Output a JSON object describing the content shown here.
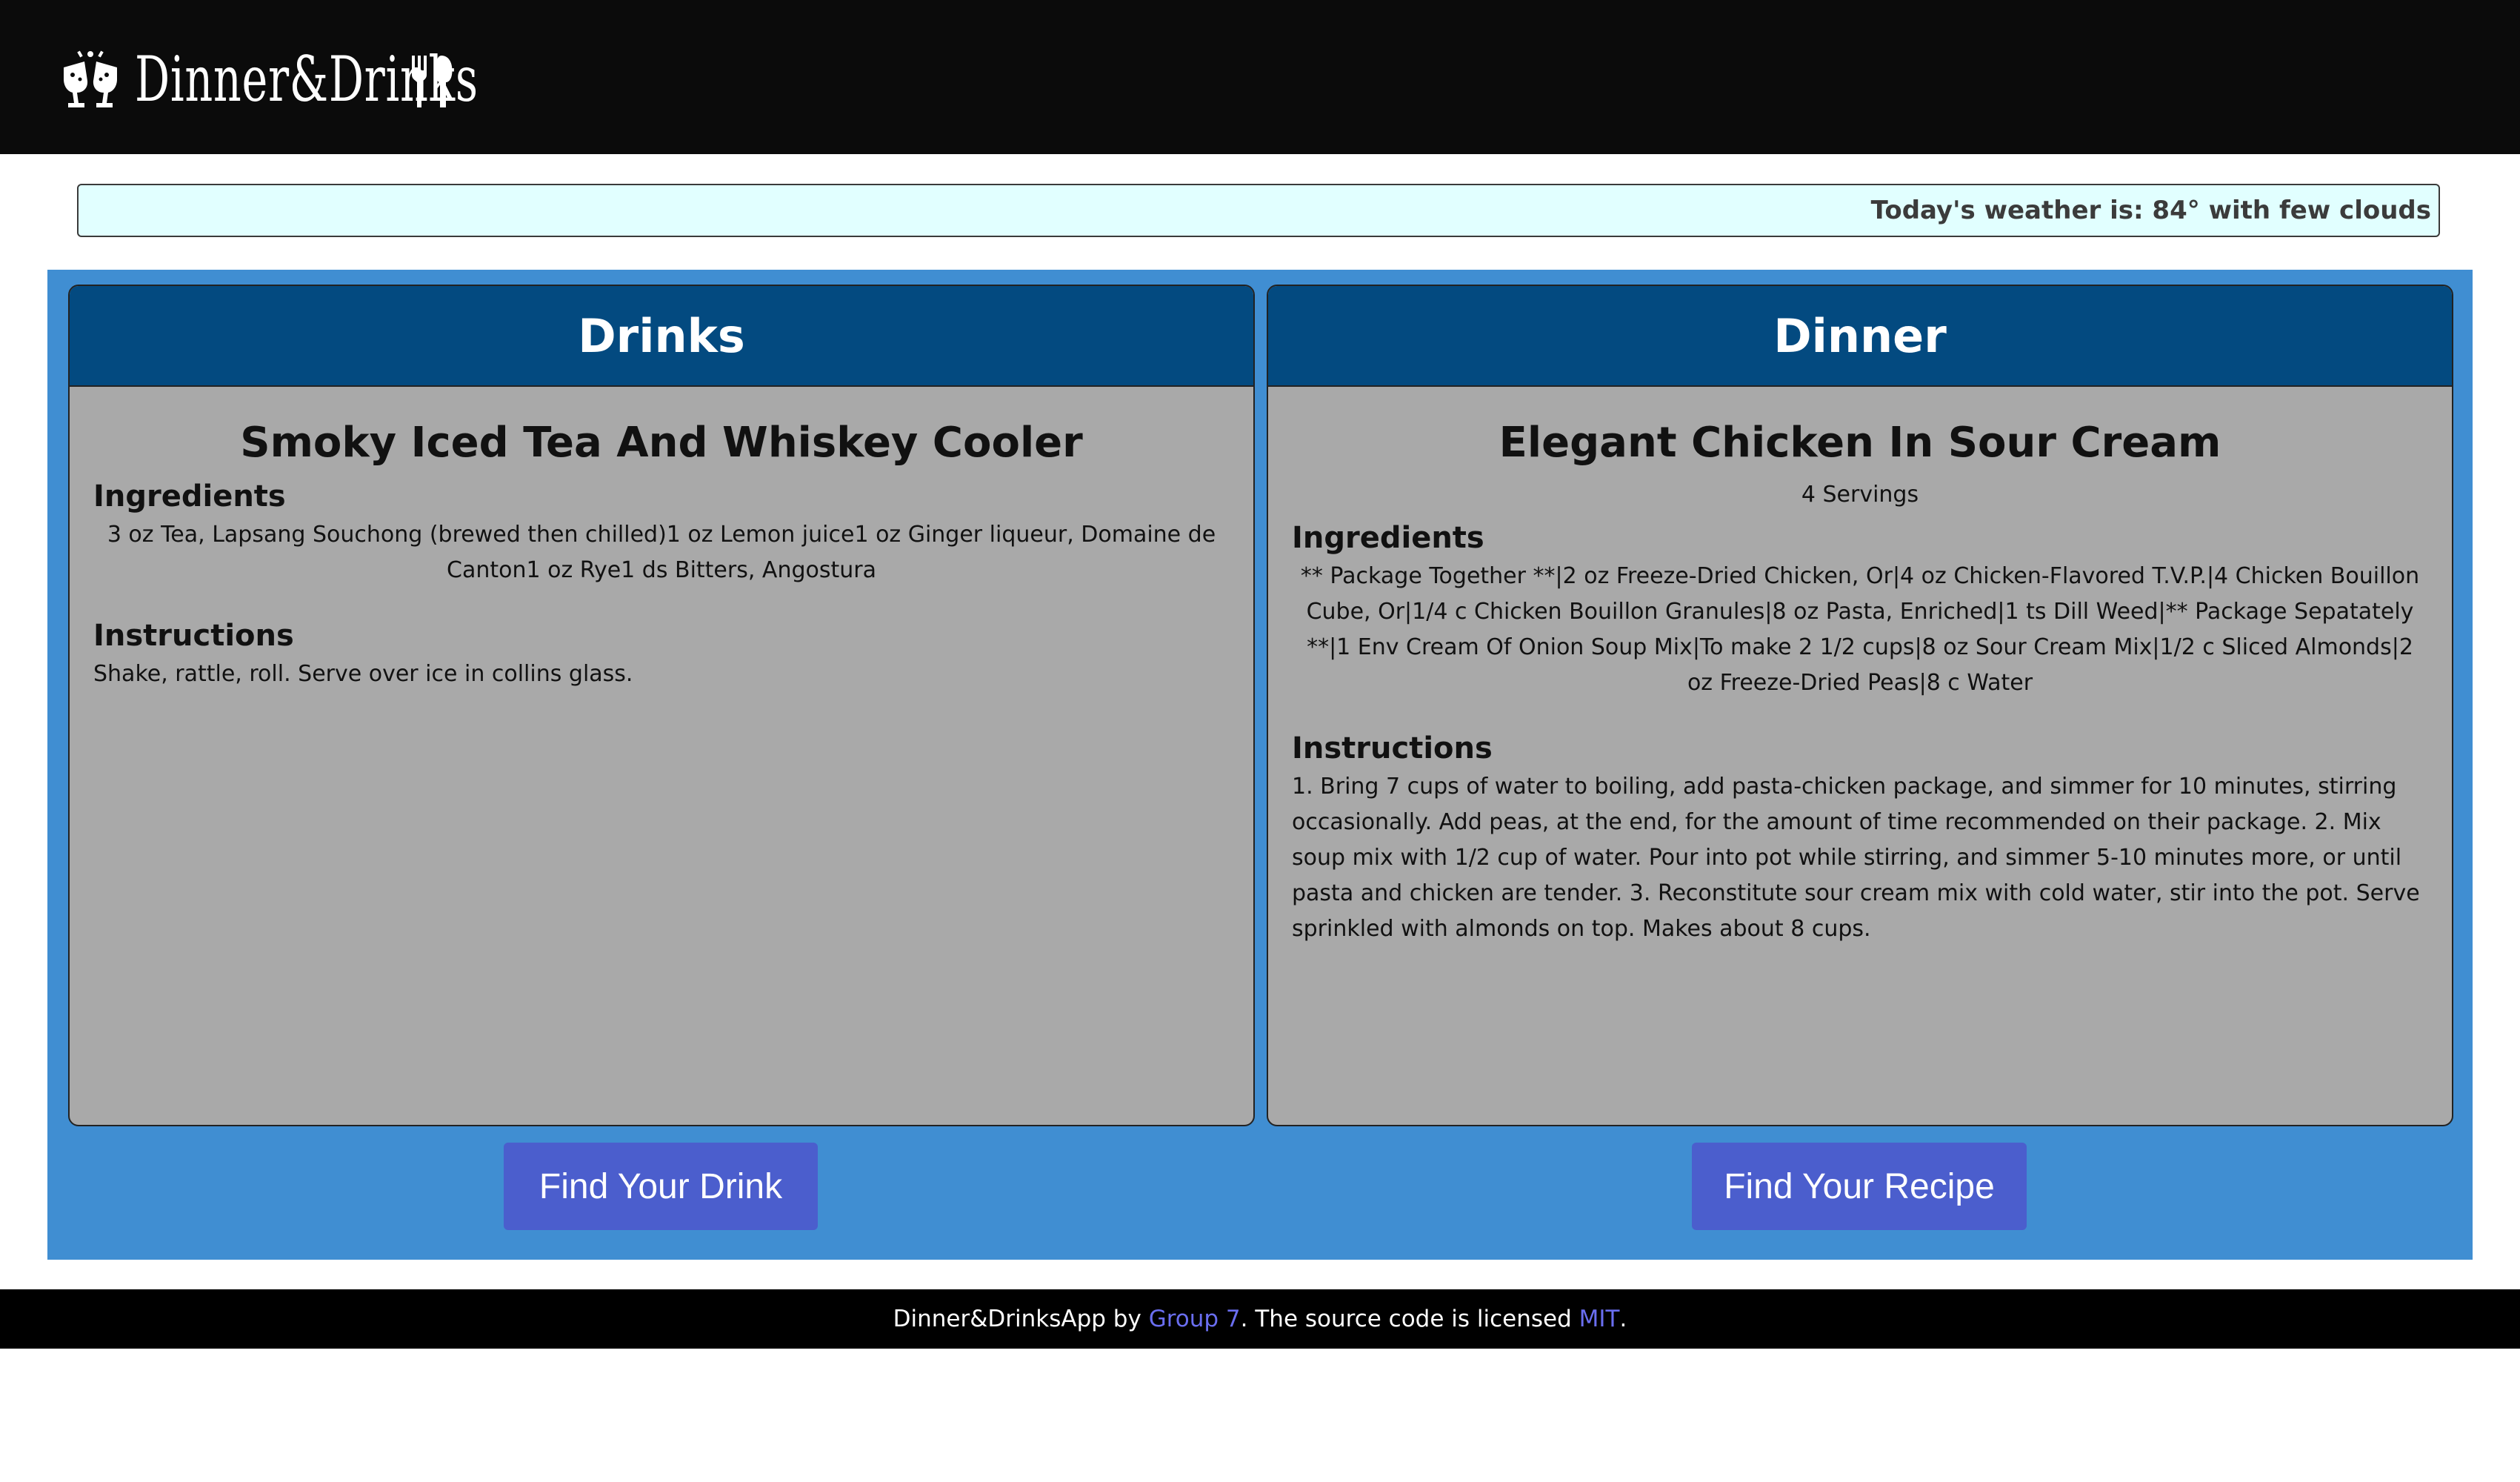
{
  "header": {
    "brand_title": "Dinner&Drinks",
    "brand_icon": "cheers-glasses-icon",
    "fork_icon": "fork-spoon-icon"
  },
  "weather": {
    "text": "Today's weather is: 84° with few clouds"
  },
  "drinks": {
    "header": "Drinks",
    "title": "Smoky Iced Tea And Whiskey Cooler",
    "ingredients_label": "Ingredients",
    "ingredients": "3 oz Tea, Lapsang Souchong (brewed then chilled)1 oz Lemon juice1 oz Ginger liqueur, Domaine de Canton1 oz Rye1 ds Bitters, Angostura",
    "instructions_label": "Instructions",
    "instructions": "Shake, rattle, roll. Serve over ice in collins glass.",
    "button": "Find Your Drink"
  },
  "dinner": {
    "header": "Dinner",
    "title": "Elegant Chicken In Sour Cream",
    "servings": "4 Servings",
    "ingredients_label": "Ingredients",
    "ingredients": "** Package Together **|2 oz Freeze-Dried Chicken, Or|4 oz Chicken-Flavored T.V.P.|4 Chicken Bouillon Cube, Or|1/4 c Chicken Bouillon Granules|8 oz Pasta, Enriched|1 ts Dill Weed|** Package Sepatately **|1 Env Cream Of Onion Soup Mix|To make 2 1/2 cups|8 oz Sour Cream Mix|1/2 c Sliced Almonds|2 oz Freeze-Dried Peas|8 c Water",
    "instructions_label": "Instructions",
    "instructions": "1. Bring 7 cups of water to boiling, add pasta-chicken package, and simmer for 10 minutes, stirring occasionally. Add peas, at the end, for the amount of time recommended on their package. 2. Mix soup mix with 1/2 cup of water. Pour into pot while stirring, and simmer 5-10 minutes more, or until pasta and chicken are tender. 3. Reconstitute sour cream mix with cold water, stir into the pot. Serve sprinkled with almonds on top. Makes about 8 cups.",
    "button": "Find Your Recipe"
  },
  "footer": {
    "prefix": "Dinner&DrinksApp by ",
    "group_link": "Group 7",
    "middle": ". The source code is licensed ",
    "license_link": "MIT",
    "suffix": "."
  },
  "colors": {
    "header_bg": "#0b0b0b",
    "weather_bg": "#e1ffff",
    "main_bg": "#408ed2",
    "card_header_bg": "#034a80",
    "card_bg": "#a9a9a9",
    "button_bg": "#4b5ecd",
    "link": "#6a6ef0"
  }
}
